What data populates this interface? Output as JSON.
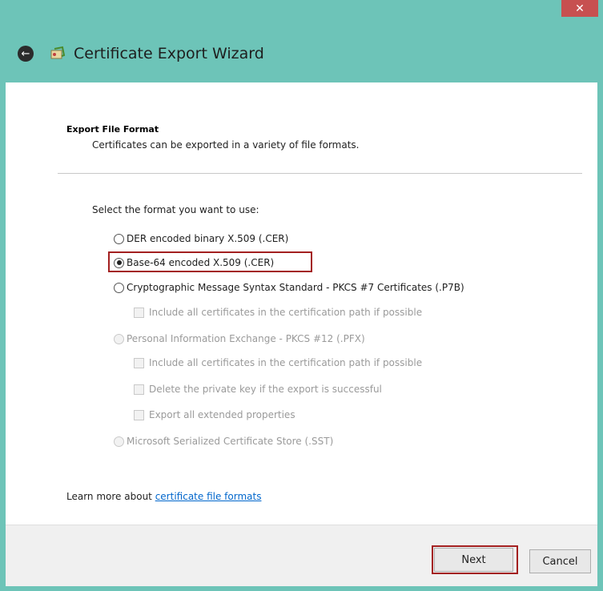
{
  "window": {
    "title": "Certificate Export Wizard",
    "close_glyph": "✕"
  },
  "header": {
    "section_title": "Export File Format",
    "section_desc": "Certificates can be exported in a variety of file formats."
  },
  "prompt": "Select the format you want to use:",
  "options": [
    {
      "label": "DER encoded binary X.509 (.CER)",
      "type": "radio",
      "checked": false,
      "enabled": true
    },
    {
      "label": "Base-64 encoded X.509 (.CER)",
      "type": "radio",
      "checked": true,
      "enabled": true
    },
    {
      "label": "Cryptographic Message Syntax Standard - PKCS #7 Certificates (.P7B)",
      "type": "radio",
      "checked": false,
      "enabled": true
    },
    {
      "label": "Include all certificates in the certification path if possible",
      "type": "checkbox",
      "checked": false,
      "enabled": false
    },
    {
      "label": "Personal Information Exchange - PKCS #12 (.PFX)",
      "type": "radio",
      "checked": false,
      "enabled": false
    },
    {
      "label": "Include all certificates in the certification path if possible",
      "type": "checkbox",
      "checked": false,
      "enabled": false
    },
    {
      "label": "Delete the private key if the export is successful",
      "type": "checkbox",
      "checked": false,
      "enabled": false
    },
    {
      "label": "Export all extended properties",
      "type": "checkbox",
      "checked": false,
      "enabled": false
    },
    {
      "label": "Microsoft Serialized Certificate Store (.SST)",
      "type": "radio",
      "checked": false,
      "enabled": false
    }
  ],
  "learn_more": {
    "prefix": "Learn more about ",
    "link_text": "certificate file formats"
  },
  "buttons": {
    "next": "Next",
    "cancel": "Cancel"
  },
  "icons": {
    "back": "back-arrow-icon",
    "wizard": "certificate-wizard-icon",
    "close": "close-icon"
  },
  "colors": {
    "title_bar": "#6dc4b8",
    "close_button": "#c75050",
    "highlight": "#a32020",
    "link": "#0066cc"
  }
}
